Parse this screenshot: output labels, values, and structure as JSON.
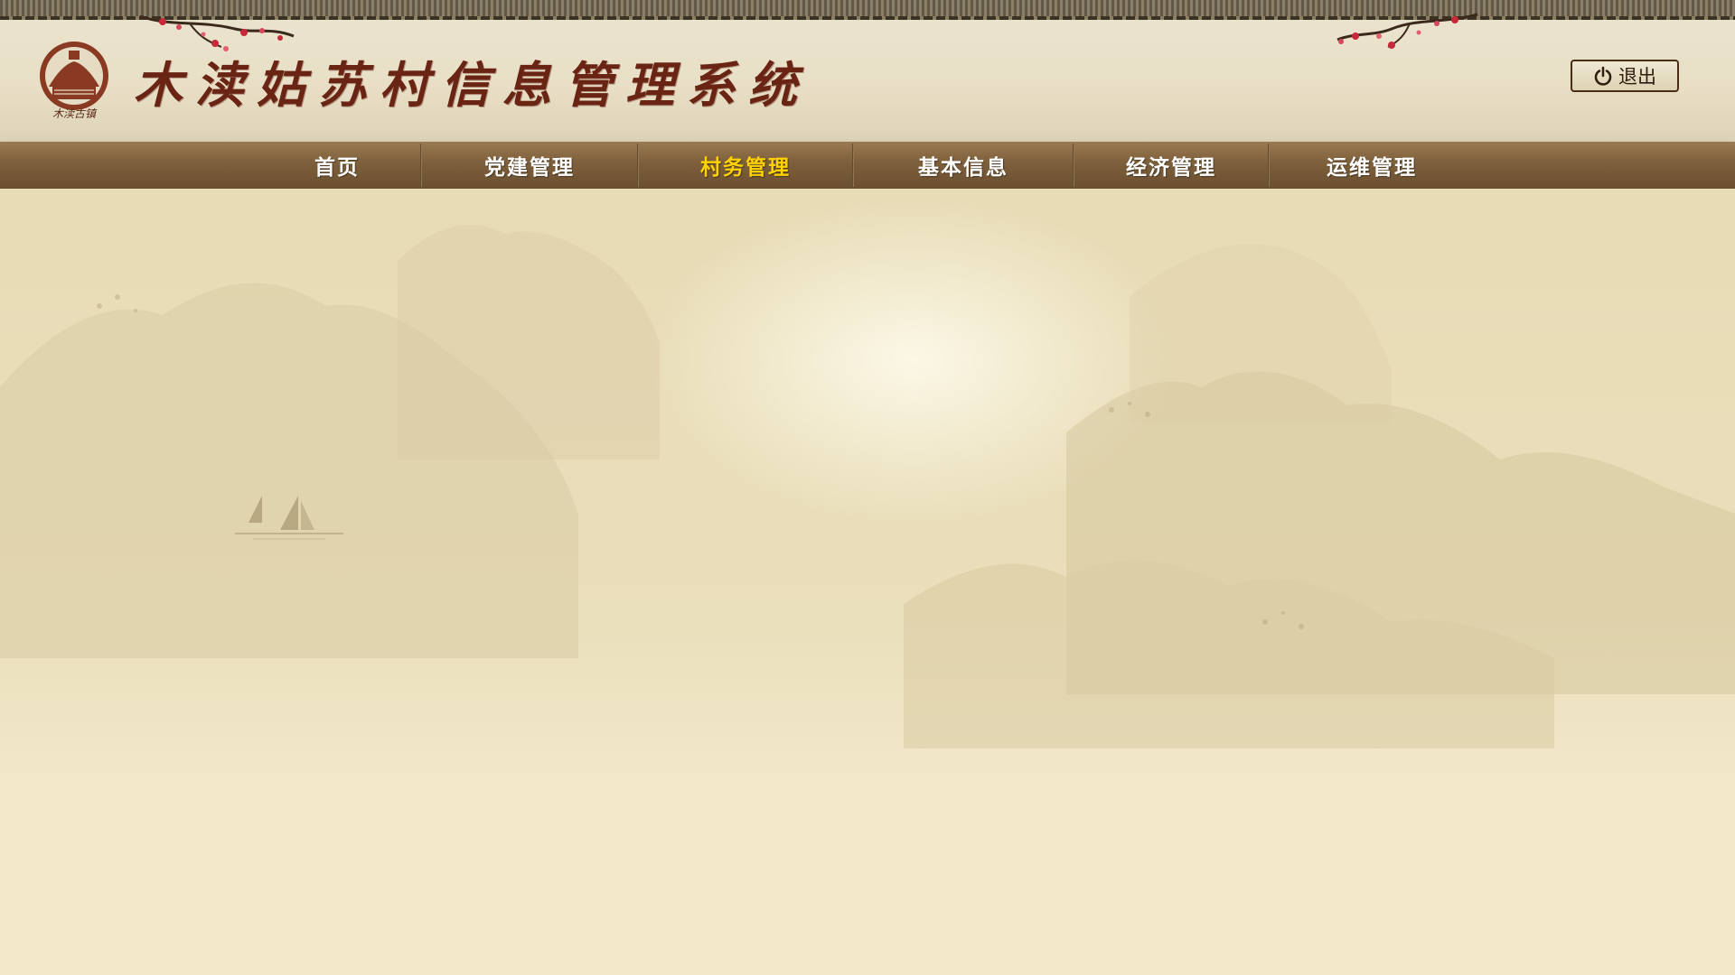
{
  "header": {
    "title": "木渎姑苏村信息管理系统",
    "logo_text": "木渎古镇",
    "logout_label": "退出",
    "logout_icon": "power-icon"
  },
  "nav": {
    "items": [
      {
        "label": "首页",
        "active": false
      },
      {
        "label": "党建管理",
        "active": false
      },
      {
        "label": "村务管理",
        "active": true
      },
      {
        "label": "基本信息",
        "active": false
      },
      {
        "label": "经济管理",
        "active": false
      },
      {
        "label": "运维管理",
        "active": false
      }
    ]
  },
  "colors": {
    "title": "#6a2414",
    "nav_bg": "#7d5f3b",
    "nav_text": "#ffffff",
    "nav_active": "#ffd200",
    "page_bg": "#f2e9cb"
  }
}
